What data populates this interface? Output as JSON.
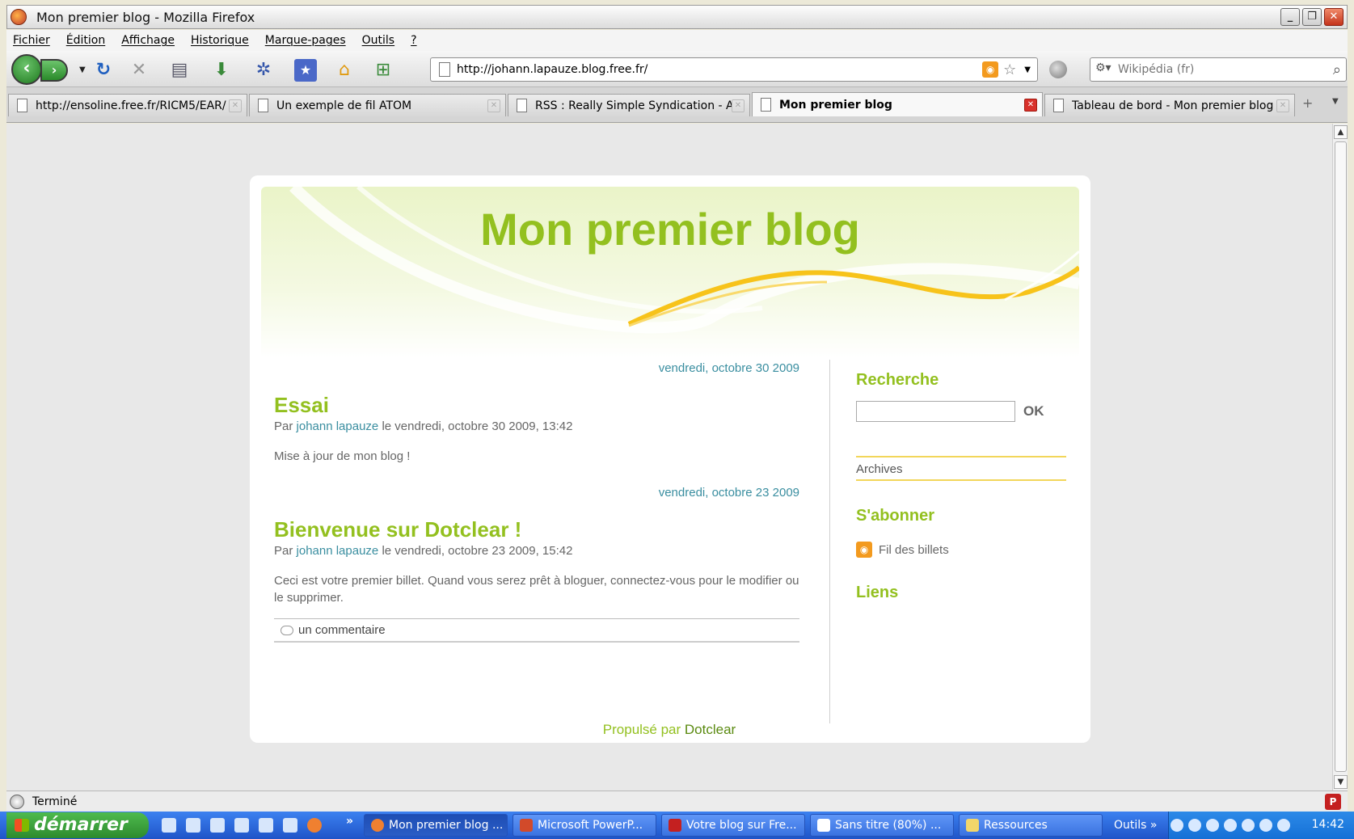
{
  "window": {
    "title": "Mon premier blog - Mozilla Firefox"
  },
  "menu": [
    "Fichier",
    "Édition",
    "Affichage",
    "Historique",
    "Marque-pages",
    "Outils",
    "?"
  ],
  "toolbar": {
    "url": "http://johann.lapauze.blog.free.fr/",
    "search_placeholder": "Wikipédia (fr)"
  },
  "tabs": [
    {
      "label": "http://ensoline.free.fr/RICM5/EAR/",
      "active": false
    },
    {
      "label": "Un exemple de fil ATOM",
      "active": false
    },
    {
      "label": "RSS : Really Simple Syndication - Avan...",
      "active": false
    },
    {
      "label": "Mon premier blog",
      "active": true
    },
    {
      "label": "Tableau de bord - Mon premier blog - ...",
      "active": false
    }
  ],
  "blog": {
    "title": "Mon premier blog",
    "posts": [
      {
        "date_header": "vendredi, octobre 30 2009",
        "title": "Essai",
        "by": "Par",
        "author": "johann lapauze",
        "when": "le vendredi, octobre 30 2009, 13:42",
        "body": "Mise à jour de mon blog !"
      },
      {
        "date_header": "vendredi, octobre 23 2009",
        "title": "Bienvenue sur Dotclear !",
        "by": "Par",
        "author": "johann lapauze",
        "when": "le vendredi, octobre 23 2009, 15:42",
        "body": "Ceci est votre premier billet. Quand vous serez prêt à bloguer, connectez-vous pour le modifier ou le supprimer.",
        "comments": "un commentaire"
      }
    ],
    "sidebar": {
      "search_heading": "Recherche",
      "search_button": "OK",
      "archives": "Archives",
      "subscribe_heading": "S'abonner",
      "feed_link": "Fil des billets",
      "links_heading": "Liens"
    },
    "footer": {
      "prefix": "Propulsé par",
      "brand": "Dotclear"
    }
  },
  "status": {
    "text": "Terminé"
  },
  "taskbar": {
    "start": "démarrer",
    "tasks": [
      {
        "label": "Mon premier blog ...",
        "active": true
      },
      {
        "label": "Microsoft PowerP...",
        "active": false
      },
      {
        "label": "Votre blog sur Fre...",
        "active": false
      },
      {
        "label": "Sans titre (80%) ...",
        "active": false
      },
      {
        "label": "Ressources",
        "active": false
      }
    ],
    "toolbar_label": "Outils",
    "clock": "14:42"
  },
  "colors": {
    "accent_green": "#93c01f",
    "link_teal": "#3a8ea0",
    "xp_blue": "#245edb"
  }
}
